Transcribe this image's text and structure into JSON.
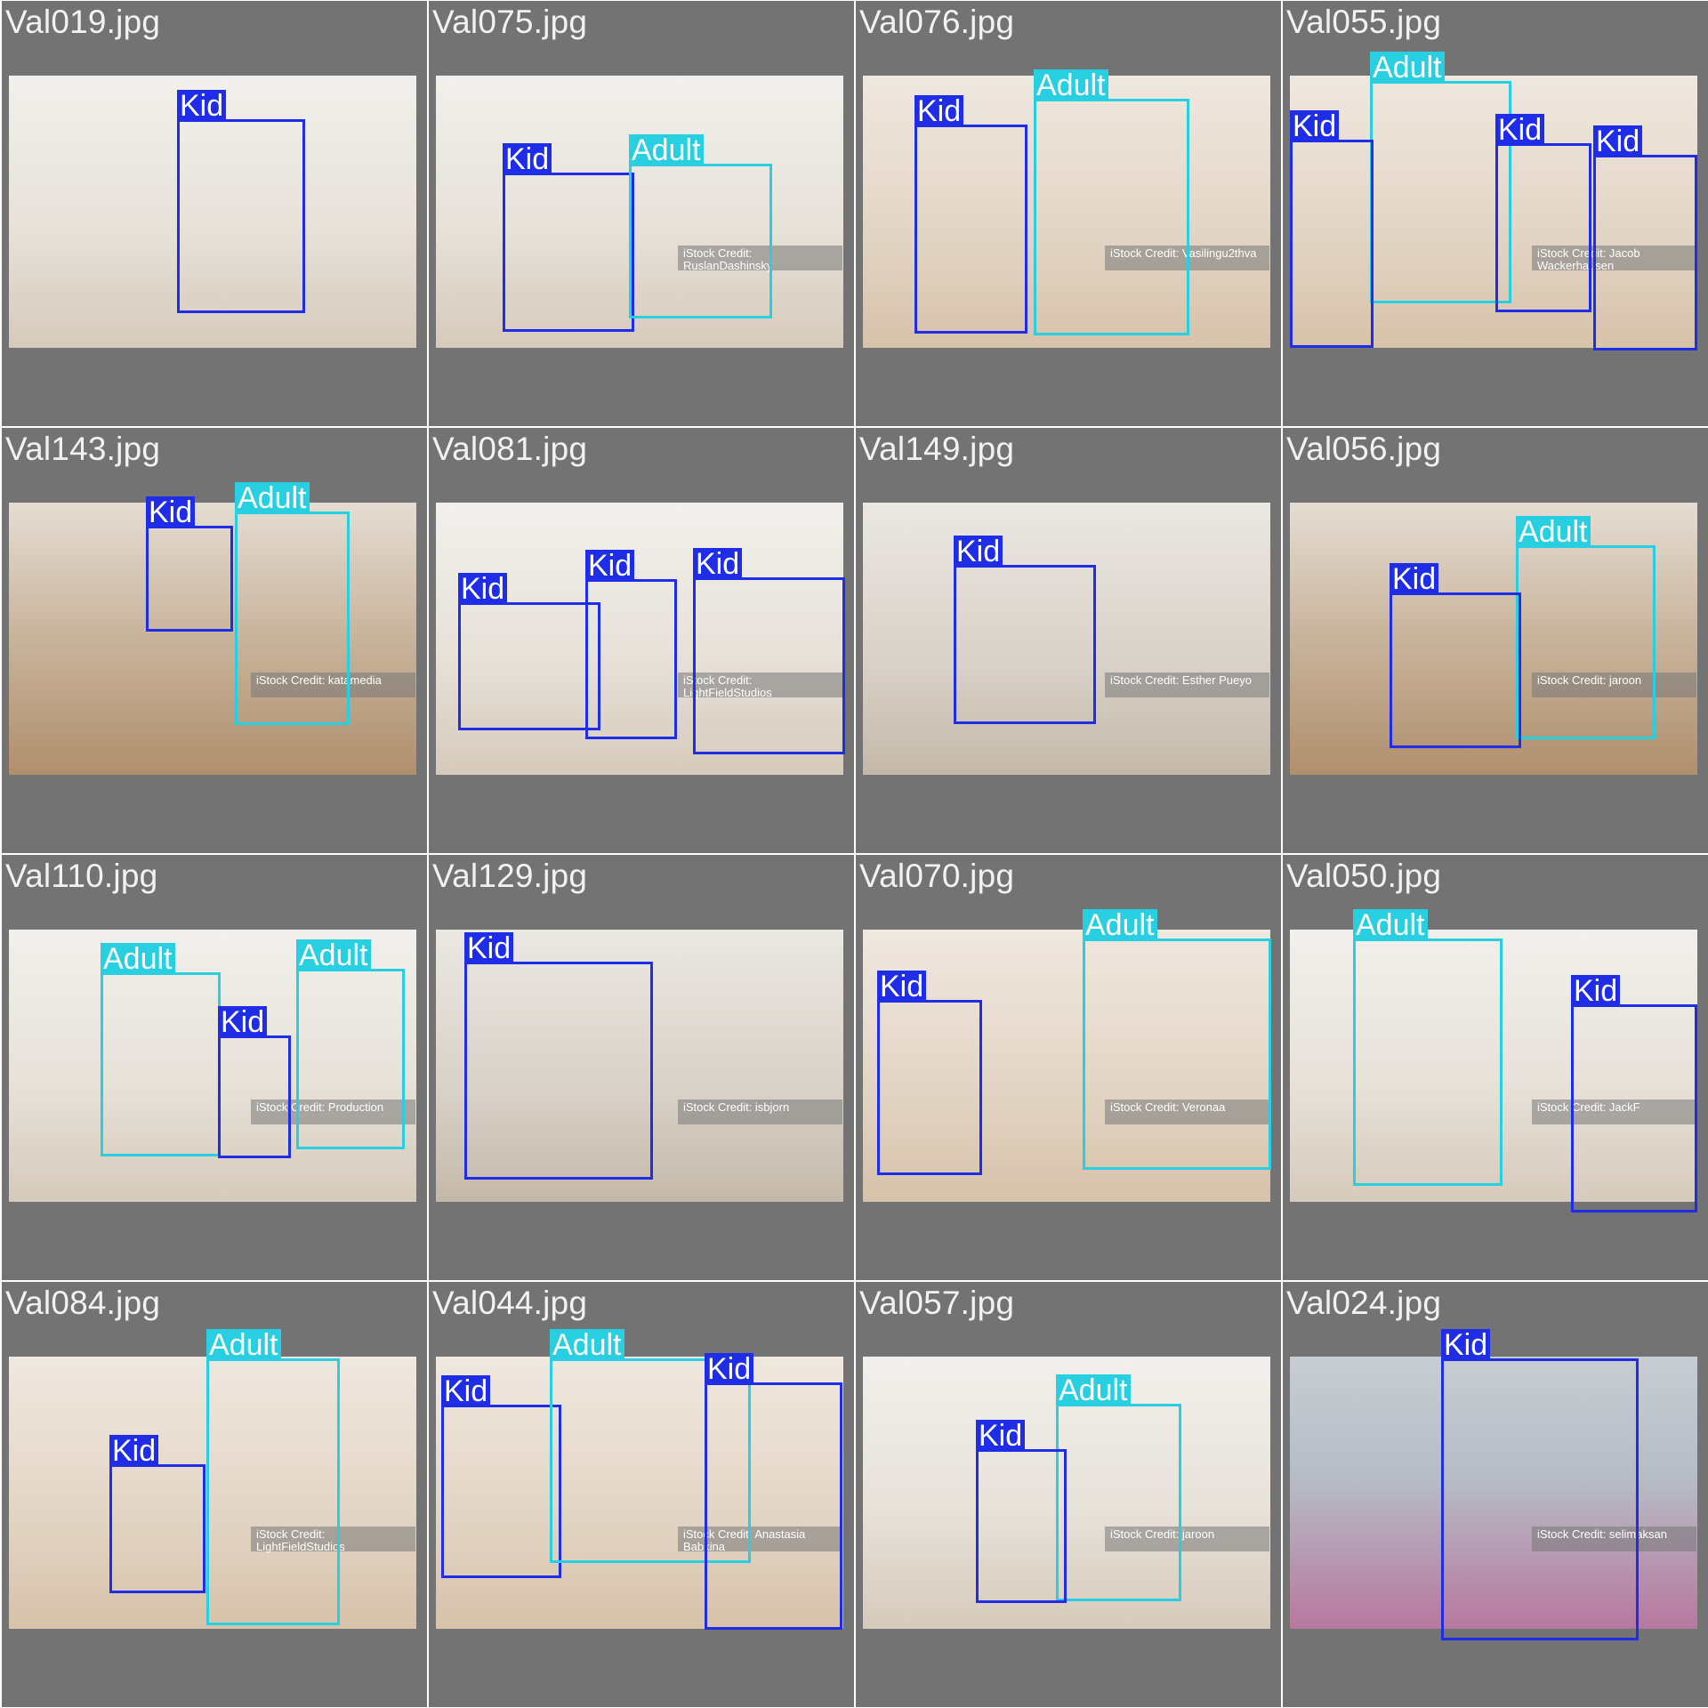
{
  "tiles": [
    {
      "file": "Val019.jpg",
      "labels": [
        "Kid"
      ],
      "watermark": ""
    },
    {
      "file": "Val075.jpg",
      "labels": [
        "Kid",
        "Adult"
      ],
      "watermark": "iStock\nCredit: RuslanDashinsky"
    },
    {
      "file": "Val076.jpg",
      "labels": [
        "Kid",
        "Adult"
      ],
      "watermark": "iStock\nCredit: Vasilingu2thva"
    },
    {
      "file": "Val055.jpg",
      "labels": [
        "Adult",
        "Kid",
        "Kid",
        "Kid"
      ],
      "watermark": "iStock\nCredit: Jacob Wackerhausen"
    },
    {
      "file": "Val143.jpg",
      "labels": [
        "Kid",
        "Adult"
      ],
      "watermark": "iStock\nCredit: katamedia"
    },
    {
      "file": "Val081.jpg",
      "labels": [
        "Kid",
        "Kid",
        "Kid"
      ],
      "watermark": "iStock\nCredit: LightFieldStudios"
    },
    {
      "file": "Val149.jpg",
      "labels": [
        "Kid"
      ],
      "watermark": "iStock\nCredit: Esther Pueyo"
    },
    {
      "file": "Val056.jpg",
      "labels": [
        "Adult",
        "Kid"
      ],
      "watermark": "iStock\nCredit: jaroon"
    },
    {
      "file": "Val110.jpg",
      "labels": [
        "Adult",
        "Kid",
        "Adult"
      ],
      "watermark": "iStock\nCredit: Production"
    },
    {
      "file": "Val129.jpg",
      "labels": [
        "Kid"
      ],
      "watermark": "iStock\nCredit: isbjorn"
    },
    {
      "file": "Val070.jpg",
      "labels": [
        "Adult",
        "Kid"
      ],
      "watermark": "iStock\nCredit: Veronaa"
    },
    {
      "file": "Val050.jpg",
      "labels": [
        "Adult",
        "Kid"
      ],
      "watermark": "iStock\nCredit: JackF"
    },
    {
      "file": "Val084.jpg",
      "labels": [
        "Adult",
        "Kid"
      ],
      "watermark": "iStock\nCredit: LightFieldStudios"
    },
    {
      "file": "Val044.jpg",
      "labels": [
        "Kid",
        "Adult",
        "Kid"
      ],
      "watermark": "iStock\nCredit: Anastasia Babkina"
    },
    {
      "file": "Val057.jpg",
      "labels": [
        "Adult",
        "Kid"
      ],
      "watermark": "iStock\nCredit: jaroon"
    },
    {
      "file": "Val024.jpg",
      "labels": [
        "Kid"
      ],
      "watermark": "iStock\nCredit: selimaksan"
    }
  ],
  "colors": {
    "Kid": "#1f2ee6",
    "Adult": "#27cfe0",
    "tile_background": "#737373"
  }
}
